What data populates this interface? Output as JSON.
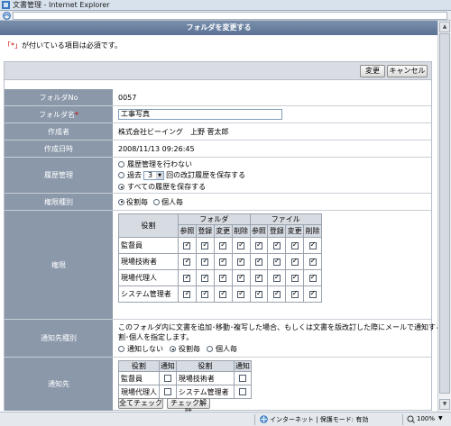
{
  "window": {
    "title": "文書管理 - Internet Explorer"
  },
  "header": {
    "title": "フォルダを変更する"
  },
  "required_note": {
    "mark": "「*」",
    "text": "が付いている項目は必須です。"
  },
  "actions": {
    "change": "変更",
    "cancel": "キャンセル"
  },
  "fields": {
    "folder_no": {
      "label": "フォルダNo",
      "value": "0057"
    },
    "folder_name": {
      "label": "フォルダ名",
      "required_mark": "*",
      "value": "工事写真"
    },
    "creator": {
      "label": "作成者",
      "value": "株式会社ビーイング　上野 菅太郎"
    },
    "created": {
      "label": "作成日時",
      "value": "2008/11/13 09:26:45"
    },
    "history": {
      "label": "履歴管理",
      "opt_none": "履歴管理を行わない",
      "opt_past_prefix": "過去",
      "opt_past_count": "3",
      "opt_past_suffix": "回の改訂履歴を保存する",
      "opt_all": "すべての履歴を保存する"
    },
    "auth_type": {
      "label": "権限種別",
      "opt_role": "役割毎",
      "opt_person": "個人毎"
    },
    "auth": {
      "label": "権限",
      "role_header": "役割",
      "folder_header": "フォルダ",
      "file_header": "ファイル",
      "sub_headers": [
        "参照",
        "登録",
        "変更",
        "削除",
        "参照",
        "登録",
        "変更",
        "削除"
      ],
      "roles": [
        "監督員",
        "現場技術者",
        "現場代理人",
        "システム管理者"
      ]
    },
    "notify_type": {
      "label": "通知先種別",
      "description_1": "このフォルダ内に文書を追加･移動･複写した場合、もしくは文書を版改訂した際にメールで通知する役",
      "description_2": "割･個人を指定します。",
      "opt_none": "通知しない",
      "opt_role": "役割毎",
      "opt_person": "個人毎"
    },
    "notify": {
      "label": "通知先",
      "role_header": "役割",
      "notify_header": "通知",
      "rows": [
        [
          "監督員",
          "現場技術者"
        ],
        [
          "現場代理人",
          "システム管理者"
        ]
      ],
      "check_all": "全てチェック",
      "uncheck": "チェック解除"
    }
  },
  "statusbar": {
    "zone": "インターネット | 保護モード: 有効",
    "zoom": "100%"
  }
}
